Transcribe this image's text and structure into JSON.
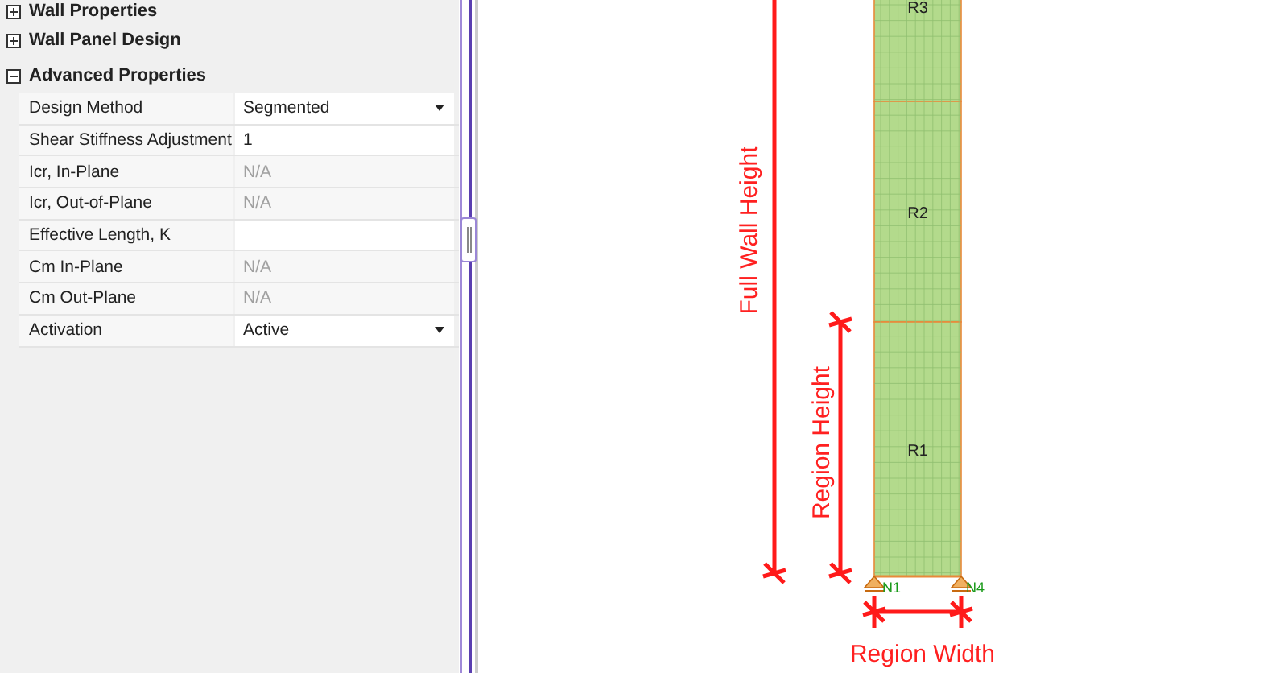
{
  "panel": {
    "sections": [
      {
        "title": "Wall Properties",
        "expanded": false
      },
      {
        "title": "Wall Panel Design",
        "expanded": false
      },
      {
        "title": "Advanced Properties",
        "expanded": true,
        "properties": [
          {
            "name": "Design Method",
            "value": "Segmented",
            "kind": "dropdown",
            "disabled": false
          },
          {
            "name": "Shear Stiffness Adjustment",
            "value": "1",
            "kind": "text",
            "disabled": false
          },
          {
            "name": "Icr, In-Plane",
            "value": "N/A",
            "kind": "text",
            "disabled": true
          },
          {
            "name": "Icr, Out-of-Plane",
            "value": "N/A",
            "kind": "text",
            "disabled": true
          },
          {
            "name": "Effective Length, K",
            "kind": "text",
            "disabled": false
          },
          {
            "name": "Cm In-Plane",
            "value": "N/A",
            "kind": "text",
            "disabled": true
          },
          {
            "name": "Cm Out-Plane",
            "value": "N/A",
            "kind": "text",
            "disabled": true
          },
          {
            "name": "Activation",
            "value": "Active",
            "kind": "dropdown",
            "disabled": false
          }
        ]
      }
    ]
  },
  "model": {
    "regions": [
      "R3",
      "R2",
      "R1"
    ],
    "nodes": [
      "N1",
      "N4"
    ],
    "dimensions": {
      "full_height": "Full Wall Height",
      "region_height": "Region Height",
      "region_width": "Region Width"
    }
  }
}
